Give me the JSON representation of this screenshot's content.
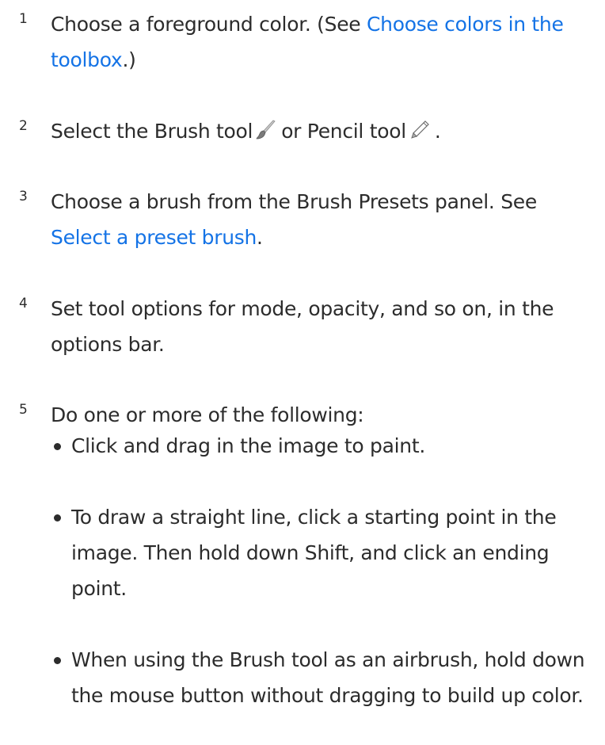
{
  "steps": [
    {
      "number": "1",
      "before": "Choose a foreground color. (See ",
      "link": "Choose colors in the toolbox",
      "after": ".)"
    },
    {
      "number": "2",
      "before": "Select the Brush tool",
      "middle": "or Pencil tool",
      "after": ".",
      "icons": [
        "brush-tool-icon",
        "pencil-tool-icon"
      ]
    },
    {
      "number": "3",
      "before": "Choose a brush from the Brush Presets panel. See ",
      "link": "Select a preset brush",
      "after": "."
    },
    {
      "number": "4",
      "text": "Set tool options for mode, opacity, and so on, in the options bar."
    },
    {
      "number": "5",
      "text": "Do one or more of the following:",
      "bullets": [
        "Click and drag in the image to paint.",
        "To draw a straight line, click a starting point in the image. Then hold down Shift, and click an ending point.",
        "When using the Brush tool as an airbrush, hold down the mouse button without dragging to build up color."
      ]
    }
  ],
  "colors": {
    "text": "#2c2c2c",
    "link": "#1473e6"
  }
}
